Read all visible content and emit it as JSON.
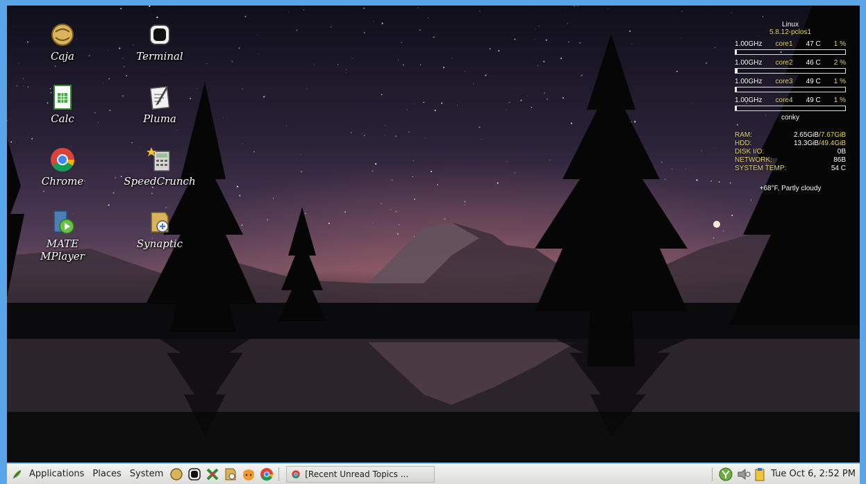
{
  "desktop_icons": [
    {
      "label": "Caja",
      "icon": "caja-file-manager-icon"
    },
    {
      "label": "Terminal",
      "icon": "terminal-icon"
    },
    {
      "label": "Calc",
      "icon": "libreoffice-calc-icon"
    },
    {
      "label": "Pluma",
      "icon": "pluma-text-editor-icon"
    },
    {
      "label": "Chrome",
      "icon": "chrome-icon"
    },
    {
      "label": "SpeedCrunch",
      "icon": "speedcrunch-calculator-icon"
    },
    {
      "label": "MATE\nMPlayer",
      "icon": "mate-mplayer-icon"
    },
    {
      "label": "Synaptic",
      "icon": "synaptic-package-manager-icon"
    }
  ],
  "conky": {
    "os": "Linux",
    "kernel": "5.8.12-pclos1",
    "cpus": [
      {
        "freq": "1.00GHz",
        "core": "core1",
        "temp": "47 C",
        "pct": "1 %",
        "load": 0.01
      },
      {
        "freq": "1.00GHz",
        "core": "core2",
        "temp": "46 C",
        "pct": "2 %",
        "load": 0.02
      },
      {
        "freq": "1.00GHz",
        "core": "core3",
        "temp": "49 C",
        "pct": "1 %",
        "load": 0.01
      },
      {
        "freq": "1.00GHz",
        "core": "core4",
        "temp": "49 C",
        "pct": "1 %",
        "load": 0.01
      }
    ],
    "name": "conky",
    "stats": [
      {
        "label": "RAM:",
        "value": "2.65GiB",
        "value2": "7.67GiB"
      },
      {
        "label": "HDD:",
        "value": "13.3GiB",
        "value2": "49.4GiB"
      },
      {
        "label": "DISK I/O:",
        "value": "0B",
        "value2": ""
      },
      {
        "label": "NETWORK:",
        "value": "86B",
        "value2": ""
      },
      {
        "label": "SYSTEM TEMP:",
        "value": "54 C",
        "value2": ""
      }
    ],
    "weather": "+68°F, Partly cloudy"
  },
  "taskbar": {
    "applications": "Applications",
    "places": "Places",
    "system": "System",
    "launchers": [
      "caja-icon",
      "terminal-icon",
      "xchat-icon",
      "synaptic-icon",
      "firefox-fox-icon",
      "chrome-icon"
    ],
    "window_title": "[Recent Unread Topics ...",
    "clock": "Tue Oct  6,  2:52 PM"
  },
  "colors": {
    "accent_yellow": "#e8d56a",
    "frame_blue": "#5aa4e8",
    "taskbar_bg": "#e6e6e3"
  }
}
